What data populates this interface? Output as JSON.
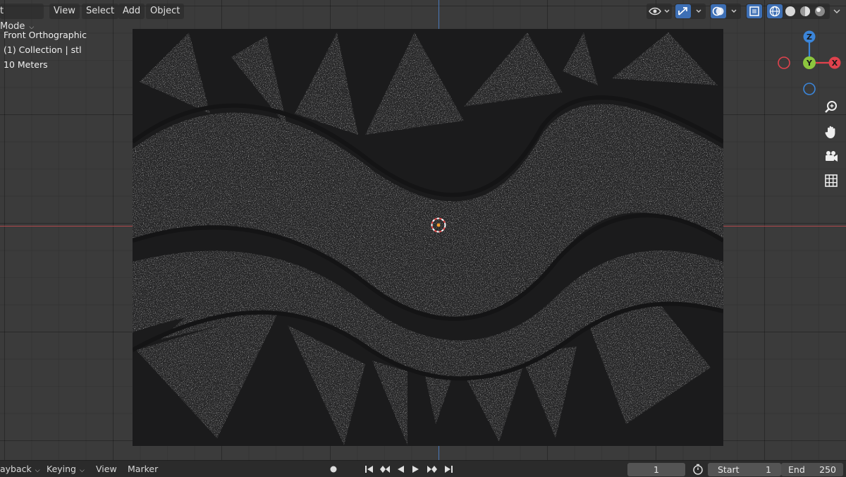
{
  "header": {
    "mode_label": "t Mode",
    "menus": [
      "View",
      "Select",
      "Add",
      "Object"
    ]
  },
  "overlay": {
    "view_name": "Front Orthographic",
    "collection": "(1) Collection | stl",
    "scale": "10 Meters"
  },
  "gizmo": {
    "axes": [
      "Z",
      "Y",
      "X"
    ],
    "colors": {
      "x": "#e0424d",
      "y": "#8cc63e",
      "z": "#3b85d9"
    }
  },
  "nav_icons": [
    "zoom-icon",
    "hand-icon",
    "camera-icon",
    "grid-icon"
  ],
  "timeline": {
    "playback_label": "ayback",
    "keying_label": "Keying",
    "view_label": "View",
    "marker_label": "Marker",
    "current_frame": "1",
    "start_label": "Start",
    "start_value": "1",
    "end_label": "End",
    "end_value": "250"
  },
  "colors": {
    "axis_x": "#b0484b",
    "axis_z": "#4a78b8",
    "active_icon": "#3d6fb5"
  }
}
